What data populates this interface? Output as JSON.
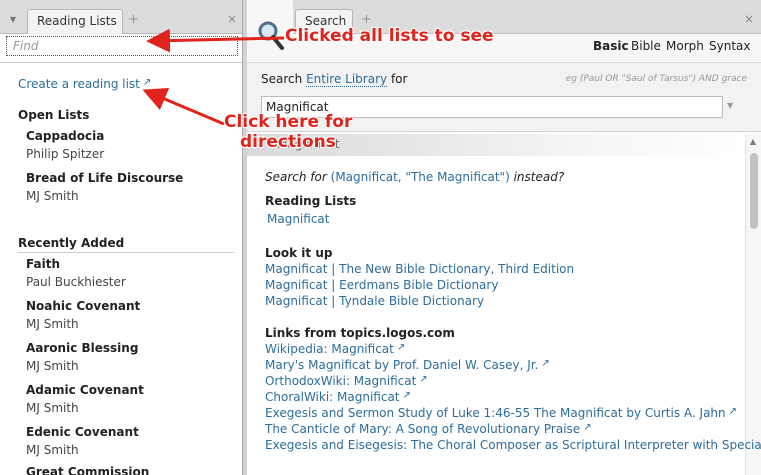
{
  "reading_lists_panel": {
    "tab_label": "Reading Lists",
    "tab_add": "+",
    "tab_close": "×",
    "find_placeholder": "Find",
    "create_link": "Create a reading list",
    "open_lists_heading": "Open Lists",
    "open_lists": [
      {
        "title": "Cappadocia",
        "author": "Philip Spitzer"
      },
      {
        "title": "Bread of Life Discourse",
        "author": "MJ Smith"
      }
    ],
    "recently_added_heading": "Recently Added",
    "recently_added": [
      {
        "title": "Faith",
        "author": "Paul Buckhiester"
      },
      {
        "title": "Noahic Covenant",
        "author": "MJ Smith"
      },
      {
        "title": "Aaronic Blessing",
        "author": "MJ Smith"
      },
      {
        "title": "Adamic Covenant",
        "author": "MJ Smith"
      },
      {
        "title": "Edenic Covenant",
        "author": "MJ Smith"
      },
      {
        "title": "Great Commission",
        "author": ""
      }
    ]
  },
  "search_panel": {
    "tab_label": "Search",
    "tab_add": "+",
    "tab_close": "×",
    "modes": [
      "Basic",
      "Bible",
      "Morph",
      "Syntax"
    ],
    "active_mode": "Basic",
    "search_prefix": "Search",
    "scope": "Entire Library",
    "search_suffix": "for",
    "example_hint": "eg (Paul OR \"Saul of Tarsus\") AND grace",
    "query_value": "Magnificat",
    "result_strip": "Magnificat",
    "search_for_prefix": "Search for",
    "search_for_link": "(Magnificat, \"The Magnificat\")",
    "search_for_suffix": "instead?",
    "reading_lists_heading": "Reading Lists",
    "reading_lists": [
      "Magnificat"
    ],
    "look_it_up_heading": "Look it up",
    "look_it_up": [
      "Magnificat | The New Bible Dictionary, Third Edition",
      "Magnificat | Eerdmans Bible Dictionary",
      "Magnificat | Tyndale Bible Dictionary"
    ],
    "topics_heading": "Links from topics.logos.com",
    "topics_links": [
      "Wikipedia: Magnificat",
      "Mary's Magnificat by Prof. Daniel W. Casey, Jr.",
      "OrthodoxWiki: Magnificat",
      "ChoralWiki: Magnificat",
      "Exegesis and Sermon Study of Luke 1:46-55 The Magnificat by Curtis A. Jahn",
      "The Canticle of Mary: A Song of Revolutionary Praise",
      "Exegesis and Eisegesis: The Choral Composer as Scriptural Interpreter with Special Ref"
    ]
  },
  "annotations": {
    "note_1": "Clicked all lists to see",
    "note_2_line1": "Click here for",
    "note_2_line2": "directions",
    "color": "#e0231c"
  },
  "icons": {
    "external_link": "↗",
    "dropdown": "▼",
    "search": "magnifier-icon"
  },
  "colors": {
    "link": "#2d6d9a",
    "annotation": "#e0231c"
  }
}
